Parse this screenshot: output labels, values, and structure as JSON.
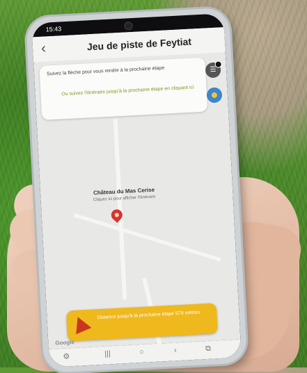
{
  "status_bar": {
    "time": "15:43"
  },
  "app_bar": {
    "back_icon": "chevron-left-icon",
    "title": "Jeu de piste de Feytiat"
  },
  "instruction_card": {
    "instruction": "Suivez la flèche pour vous rendre à la prochaine étape",
    "follow_hint": "Ou suivez l'itinéraire jusqu'à la prochaine étape en cliquant ici"
  },
  "map": {
    "place_name": "Château du Mas Cerise",
    "place_hint": "Cliquez ici pour afficher l'itinéraire",
    "pin_color": "#d8342b",
    "attribution": "Google"
  },
  "cta": {
    "text": "Distance jusqu'à la prochaine étape 579 mètres",
    "color": "#efb81d"
  },
  "controls": {
    "list_icon": "list-icon",
    "location_icon": "my-location-icon"
  }
}
